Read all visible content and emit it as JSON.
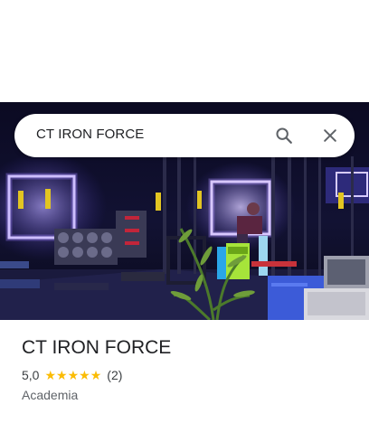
{
  "search": {
    "query": "CT IRON FORCE"
  },
  "icons": {
    "search": "search-icon",
    "close": "close-icon",
    "star": "star-icon"
  },
  "place": {
    "name": "CT IRON FORCE",
    "rating": "5,0",
    "stars": 5,
    "review_count": "(2)",
    "category": "Academia"
  },
  "colors": {
    "star": "#fbbc04",
    "title_text": "#202124",
    "secondary_text": "#5f6368"
  }
}
